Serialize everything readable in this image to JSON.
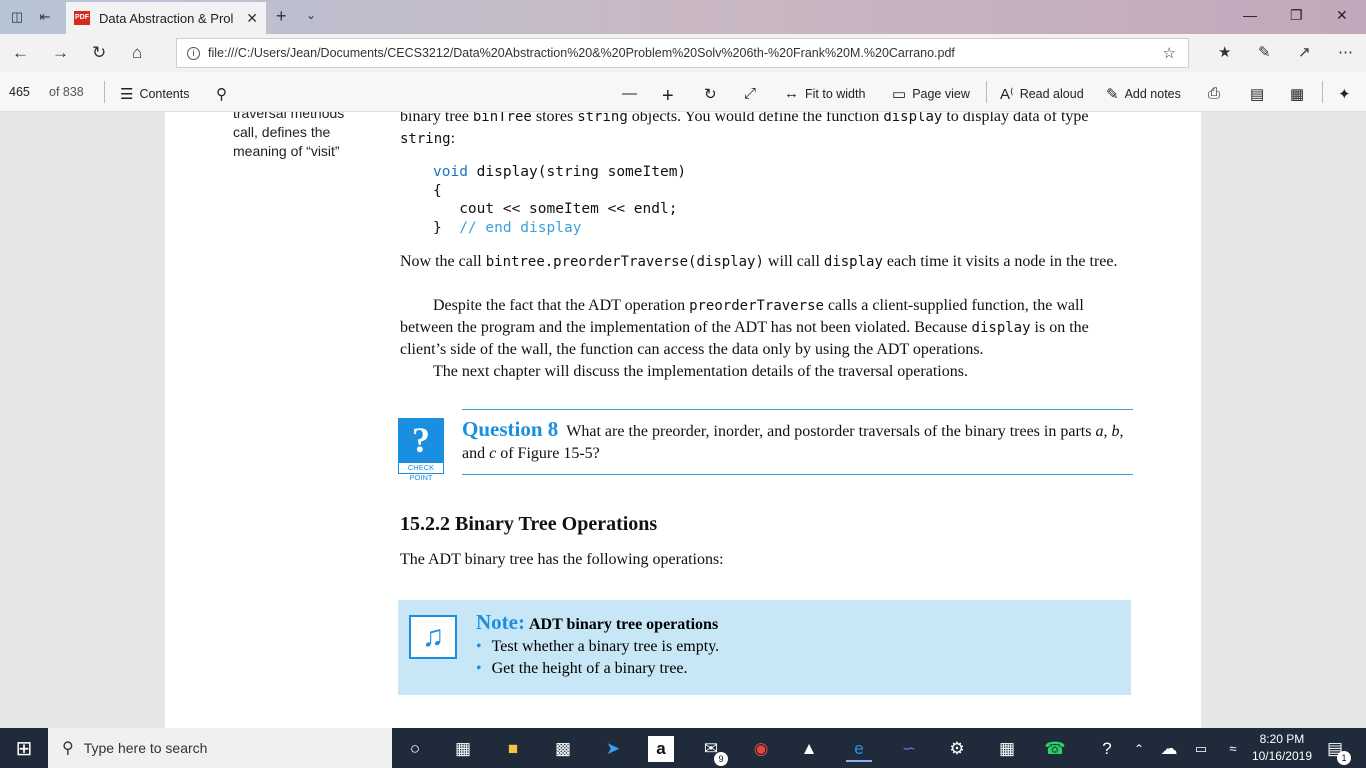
{
  "browser": {
    "tab_title": "Data Abstraction & Prol",
    "pdf_badge": "PDF",
    "url": "file:///C:/Users/Jean/Documents/CECS3212/Data%20Abstraction%20&%20Problem%20Solv%206th-%20Frank%20M.%20Carrano.pdf"
  },
  "pdf_toolbar": {
    "page_current": "465",
    "page_total": "of 838",
    "contents": "Contents",
    "fit_to_width": "Fit to width",
    "page_view": "Page view",
    "read_aloud": "Read aloud",
    "add_notes": "Add notes"
  },
  "document": {
    "sidenote": "traversal methods call, defines the meaning of “visit”",
    "intro_part1": "binary tree ",
    "intro_code1": "binTree",
    "intro_part2": " stores ",
    "intro_code2": "string",
    "intro_part3": " objects. You would define the function ",
    "intro_code3": "display",
    "intro_part4": " to display data of type ",
    "intro_code4": "string",
    "intro_part5": ":",
    "code_keyword": "void",
    "code_sig": " display(string someItem)",
    "code_open": "{",
    "code_body": "   cout << someItem << endl;",
    "code_close": "}",
    "code_comment": "// end display",
    "p1_a": "Now the call ",
    "p1_code1": "bintree.preorderTraverse(display)",
    "p1_b": " will call ",
    "p1_code2": "display",
    "p1_c": " each time it visits a node in the tree.",
    "p2_a": "Despite the fact that the ADT operation ",
    "p2_code1": "preorderTraverse",
    "p2_b": " calls a client-supplied function, the wall between the program and the implementation of the ADT has not been violated. Because ",
    "p2_code2": "display",
    "p2_c": " is on the client’s side of the wall, the function can access the data only by using the ADT operations.",
    "p3": "The next chapter will discuss the implementation details of the traversal operations.",
    "checkpoint_mark": "?",
    "checkpoint_label": "CHECK POINT",
    "question_label": "Question 8",
    "question_text_a": "What are the preorder, inorder, and postorder traversals of the binary trees in parts ",
    "question_a": "a",
    "question_sep1": ", ",
    "question_b": "b",
    "question_sep2": ", and ",
    "question_c": "c",
    "question_text_b": " of Figure 15-5?",
    "section_heading": "15.2.2  Binary Tree Operations",
    "section_text": "The ADT binary tree has the following operations:",
    "note_label": "Note:",
    "note_title": "ADT binary tree operations",
    "note_items": [
      "Test whether a binary tree is empty.",
      "Get the height of a binary tree."
    ]
  },
  "taskbar": {
    "search_placeholder": "Type here to search",
    "mail_badge": "9",
    "time": "8:20 PM",
    "date": "10/16/2019",
    "notif_count": "1"
  }
}
